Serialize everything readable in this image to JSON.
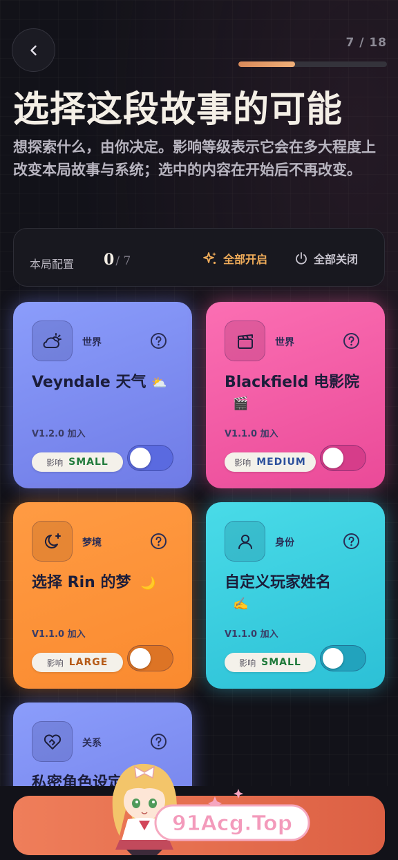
{
  "header": {
    "counter": "7 / 18",
    "progress": 0.38
  },
  "title": "选择这段故事的可能",
  "subtitle": "想探索什么，由你决定。影响等级表示它会在多大程度上改变本局故事与系统；选中的内容在开始后不再改变。",
  "config": {
    "label": "本局配置",
    "count": "0",
    "total": "/ 7",
    "enable_all": "全部开启",
    "disable_all": "全部关闭"
  },
  "cards": [
    {
      "category": "世界",
      "name": "Veyndale 天气",
      "emoji": "⛅",
      "version": "V1.2.0 加入",
      "impact_label": "影响",
      "impact": "SMALL",
      "impact_color": "#1f7a3a",
      "enabled": false
    },
    {
      "category": "世界",
      "name": "Blackfield 电影院",
      "emoji": "🎬",
      "version": "V1.1.0 加入",
      "impact_label": "影响",
      "impact": "MEDIUM",
      "impact_color": "#2b4f9c",
      "enabled": false
    },
    {
      "category": "梦境",
      "name": "选择 Rin 的梦",
      "emoji": "🌙",
      "version": "V1.1.0 加入",
      "impact_label": "影响",
      "impact": "LARGE",
      "impact_color": "#b65a16",
      "enabled": false
    },
    {
      "category": "身份",
      "name": "自定义玩家姓名",
      "emoji": "✍️",
      "version": "V1.1.0 加入",
      "impact_label": "影响",
      "impact": "SMALL",
      "impact_color": "#1f7a3a",
      "enabled": false
    },
    {
      "category": "关系",
      "name": "私密角色设定",
      "emoji": "",
      "version": "",
      "impact_label": "",
      "impact": "",
      "impact_color": "#1f7a3a",
      "enabled": false
    }
  ],
  "watermark": "91Acg.Top",
  "colors": {
    "accent": "#f1ad5a",
    "bottom_button": "#e36d4d"
  }
}
